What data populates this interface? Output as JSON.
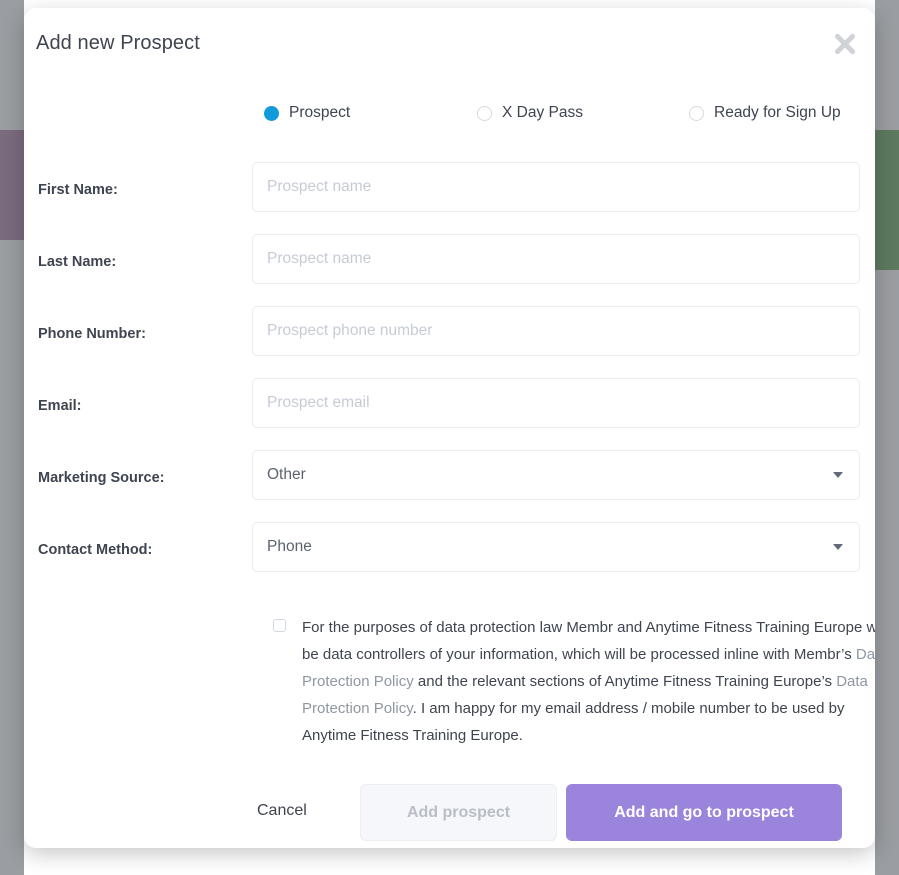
{
  "backdrop": {
    "strip_color": "#9a9da1",
    "purple_block_color": "#7a6b7e",
    "green_block_color": "#5d7a60"
  },
  "modal": {
    "title": "Add new Prospect",
    "close_icon": "close-icon",
    "accent_selected": "#129bdb",
    "accent_primary": "#9b85dc"
  },
  "prospect_type": {
    "options": [
      {
        "label": "Prospect",
        "selected": true
      },
      {
        "label": "X Day Pass",
        "selected": false
      },
      {
        "label": "Ready for Sign Up",
        "selected": false
      }
    ]
  },
  "form": {
    "fields": [
      {
        "label": "First Name:",
        "type": "text",
        "value": "",
        "placeholder": "Prospect name"
      },
      {
        "label": "Last Name:",
        "type": "text",
        "value": "",
        "placeholder": "Prospect name"
      },
      {
        "label": "Phone Number:",
        "type": "text",
        "value": "",
        "placeholder": "Prospect phone number"
      },
      {
        "label": "Email:",
        "type": "text",
        "value": "",
        "placeholder": "Prospect email"
      },
      {
        "label": "Marketing Source:",
        "type": "select",
        "value": "Other"
      },
      {
        "label": "Contact Method:",
        "type": "select",
        "value": "Phone"
      }
    ]
  },
  "consent": {
    "checked": false,
    "part1": "For the purposes of data protection law Membr and Anytime Fitness Training Europe will be data controllers of your information, which will be processed inline with Membr’s ",
    "link1": "Data Protection Policy",
    "part2": " and the relevant sections of Anytime Fitness Training Europe’s ",
    "link2": "Data Protection Policy",
    "part3": ". I am happy for my email address / mobile number to be used by Anytime Fitness Training Europe."
  },
  "footer": {
    "cancel_label": "Cancel",
    "add_prospect_label": "Add prospect",
    "add_and_go_label": "Add and go to prospect"
  }
}
